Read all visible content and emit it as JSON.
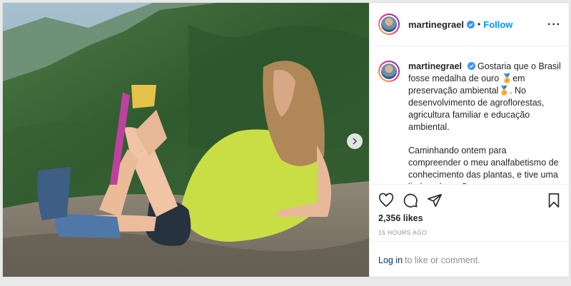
{
  "post": {
    "username": "martinegrael",
    "verified": true,
    "follow_label": "Follow",
    "more_icon": "more-options-icon"
  },
  "caption": {
    "username": "martinegrael",
    "line1": "Gostaria que o Brasil fosse medalha de ouro 🏅em preservação ambiental🏅. No desenvolvimento de agroflorestas, agricultura familiar e educação ambiental.",
    "line2": "Caminhando ontem para compreender o meu analfabetismo de conhecimento das plantas, e tive uma linda aula no Sana."
  },
  "stats": {
    "likes": "2,356 likes",
    "time": "15 HOURS AGO"
  },
  "login": {
    "link": "Log in",
    "text": "to like or comment."
  },
  "colors": {
    "follow": "#0095f6",
    "verified": "#3897f0"
  }
}
